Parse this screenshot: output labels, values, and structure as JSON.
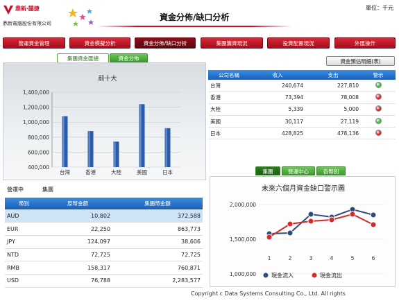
{
  "header": {
    "brand": "鼎新‧囍捷",
    "company": "鼎新電腦股份有限公司",
    "page_title": "資金分佈/缺口分析",
    "unit": "單位：千元"
  },
  "nav": [
    {
      "label": "營運資金管理"
    },
    {
      "label": "資金模擬分析"
    },
    {
      "label": "資金分佈/缺口分析",
      "active": true
    },
    {
      "label": "集團籌資現況"
    },
    {
      "label": "投資配置現況"
    },
    {
      "label": "外匯操作"
    }
  ],
  "left_tabs": [
    {
      "label": "集團資金匯總",
      "active": true
    },
    {
      "label": "資金分佈",
      "active": false
    }
  ],
  "chart_data": [
    {
      "type": "bar",
      "title": "前十大",
      "categories": [
        "台灣",
        "香港",
        "大陸",
        "美國",
        "日本"
      ],
      "values": [
        1080000,
        880000,
        740000,
        1240000,
        920000
      ],
      "ylim": [
        400000,
        1400000
      ],
      "yticks": [
        "1,400,000",
        "1,200,000",
        "1,000,000",
        "800,000",
        "600,000",
        "400,000"
      ],
      "color": "#2a5aa8",
      "grid": true
    },
    {
      "type": "line",
      "title": "未來六個月資金缺口警示圖",
      "x": [
        1,
        2,
        3,
        4,
        5,
        6
      ],
      "series": [
        {
          "name": "現金流入",
          "values": [
            1580000,
            1590000,
            1860000,
            1820000,
            1930000,
            1850000
          ],
          "color": "#2e4a7a"
        },
        {
          "name": "現金流出",
          "values": [
            1530000,
            1720000,
            1760000,
            1780000,
            1860000,
            1710000
          ],
          "color": "#d42a2a"
        }
      ],
      "ylim": [
        1000000,
        2100000
      ],
      "yticks": [
        "2,000,000",
        "1,500,000",
        "1,000,000"
      ],
      "legend": "bottom"
    }
  ],
  "status": {
    "label1": "營運中",
    "label2": "集團"
  },
  "currency_table": {
    "headers": [
      "幣別",
      "原幣金額",
      "集團幣金額"
    ],
    "rows": [
      [
        "AUD",
        "10,802",
        "372,588"
      ],
      [
        "EUR",
        "22,250",
        "863,773"
      ],
      [
        "JPY",
        "124,097",
        "38,606"
      ],
      [
        "NTD",
        "72,725",
        "72,725"
      ],
      [
        "RMB",
        "158,317",
        "760,871"
      ],
      [
        "USD",
        "76,788",
        "2,283,577"
      ]
    ]
  },
  "estimate_button": "資金預估明細(表)",
  "company_table": {
    "headers": [
      "公司名稱",
      "收入",
      "支出",
      "警示"
    ],
    "rows": [
      {
        "name": "台灣",
        "income": "240,674",
        "expense": "227,810",
        "alert": "green"
      },
      {
        "name": "香港",
        "income": "73,394",
        "expense": "78,008",
        "alert": "red"
      },
      {
        "name": "大陸",
        "income": "5,339",
        "expense": "5,000",
        "alert": "red"
      },
      {
        "name": "美國",
        "income": "30,117",
        "expense": "27,119",
        "alert": "green"
      },
      {
        "name": "日本",
        "income": "428,825",
        "expense": "478,136",
        "alert": "red"
      }
    ]
  },
  "right_tabs": [
    {
      "label": "集團",
      "active": true
    },
    {
      "label": "營運中心",
      "active": false
    },
    {
      "label": "各幣別",
      "active": false
    }
  ],
  "footer": "Copyright c Data Systems Consulting Co., Ltd. All rights"
}
